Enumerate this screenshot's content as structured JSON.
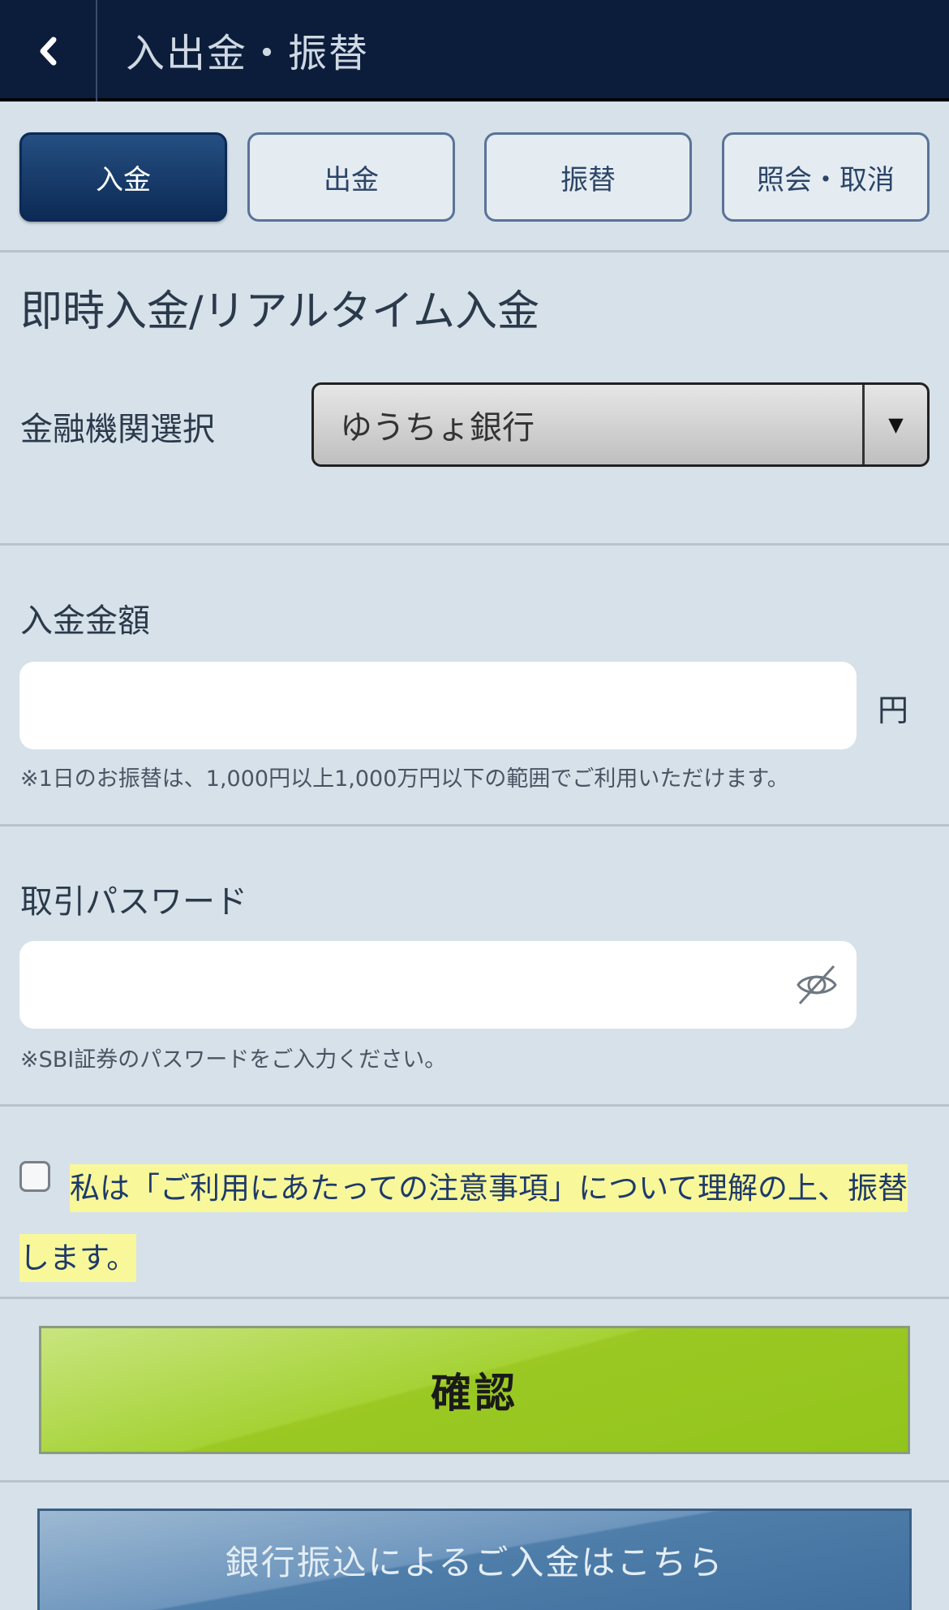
{
  "header": {
    "title": "入出金・振替",
    "back_icon": "chevron-left-icon"
  },
  "tabs": [
    {
      "label": "入金",
      "active": true
    },
    {
      "label": "出金",
      "active": false
    },
    {
      "label": "振替",
      "active": false
    },
    {
      "label": "照会・取消",
      "active": false
    }
  ],
  "section_title": "即時入金/リアルタイム入金",
  "institution": {
    "label": "金融機関選択",
    "selected": "ゆうちょ銀行",
    "arrow": "▼"
  },
  "amount": {
    "label": "入金金額",
    "value": "",
    "unit": "円",
    "note": "※1日のお振替は、1,000円以上1,000万円以下の範囲でご利用いただけます。"
  },
  "password": {
    "label": "取引パスワード",
    "value": "",
    "note": "※SBI証券のパスワードをご入力ください。",
    "toggle_icon": "eye-slash-icon"
  },
  "agreement": {
    "checked": false,
    "text": "私は「ご利用にあたっての注意事項」について理解の上、振替します。"
  },
  "buttons": {
    "confirm": "確認",
    "bank_transfer": "銀行振込によるご入金はこちら"
  },
  "colors": {
    "header_bg": "#0b1d3a",
    "page_bg": "#d6e1ea",
    "active_tab": "#0c2a55",
    "confirm_green": "#9bc823",
    "highlight": "#f8f89a"
  }
}
